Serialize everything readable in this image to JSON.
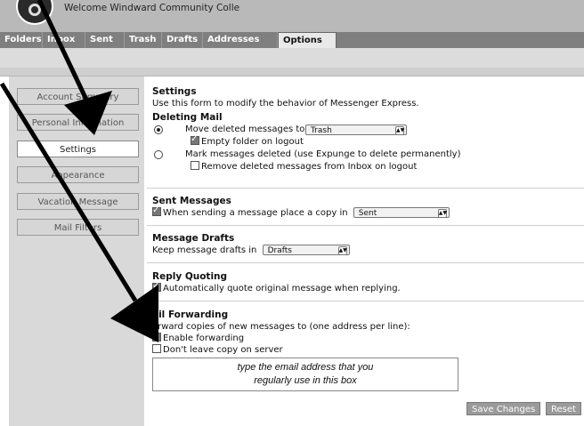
{
  "header": {
    "title": "Welcome Windward Community Colle"
  },
  "tabs": [
    "Folders",
    "Inbox",
    "Sent",
    "Trash",
    "Drafts",
    "Addresses",
    "Options"
  ],
  "sidebar": {
    "items": [
      "Account Summary",
      "Personal Information",
      "Settings",
      "Appearance",
      "Vacation Message",
      "Mail Filters"
    ],
    "active": "Settings"
  },
  "settings": {
    "title": "Settings",
    "description": "Use this form to modify the behavior of Messenger Express."
  },
  "deleting": {
    "title": "Deleting Mail",
    "move_label": "Move deleted messages to",
    "move_folder": "Trash",
    "empty_label": "Empty folder on logout",
    "mark_label": "Mark messages deleted (use Expunge to delete permanently)",
    "remove_label": "Remove deleted messages from Inbox on logout"
  },
  "sent": {
    "title": "Sent Messages",
    "copy_label": "When sending a message place a copy in",
    "folder": "Sent"
  },
  "drafts": {
    "title": "Message Drafts",
    "keep_label": "Keep message drafts in",
    "folder": "Drafts"
  },
  "reply": {
    "title": "Reply Quoting",
    "auto_label": "Automatically quote original message when replying."
  },
  "forwarding": {
    "title": "ail Forwarding",
    "description": "orward copies of new messages to (one address per line):",
    "enable_label": "Enable forwarding",
    "dont_leave_label": "Don't leave copy on server",
    "address_line1": "type the email address that you",
    "address_line2": "regularly use in this box"
  },
  "buttons": {
    "save": "Save Changes",
    "reset": "Reset"
  },
  "colors": {
    "topbar": "#b9b9b9",
    "tabbar": "#7f7f7f",
    "sidebar": "#d9d9d9",
    "arrow": "#000000"
  }
}
